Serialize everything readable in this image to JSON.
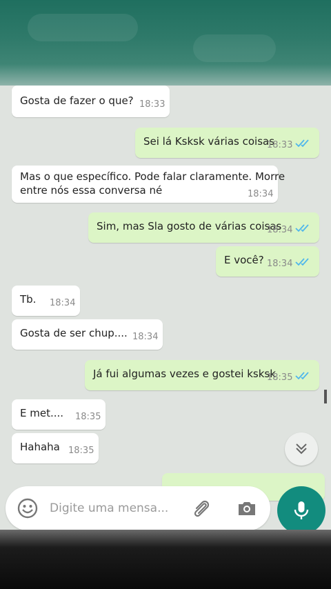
{
  "messages": [
    {
      "dir": "in",
      "text": "Gosta de fazer o que?",
      "time": "18:33"
    },
    {
      "dir": "out",
      "text": "Sei lá Ksksk várias coisas",
      "time": "18:33"
    },
    {
      "dir": "in",
      "text_lines": [
        "Mas o que específico. Pode falar claramente.  Morre",
        "entre nós essa conversa né"
      ],
      "time": "18:34"
    },
    {
      "dir": "out",
      "text": "Sim, mas Sla gosto de várias coisas",
      "time": "18:34"
    },
    {
      "dir": "out",
      "text": "E você?",
      "time": "18:34"
    },
    {
      "dir": "in",
      "text": "Tb.",
      "time": "18:34"
    },
    {
      "dir": "in",
      "text": "Gosta de ser chup....",
      "time": "18:34"
    },
    {
      "dir": "out",
      "text": "Já fui algumas vezes e gostei ksksk",
      "time": "18:35"
    },
    {
      "dir": "in",
      "text": "E met....",
      "time": "18:35"
    },
    {
      "dir": "in",
      "text": "Hahaha",
      "time": "18:35"
    }
  ],
  "composer": {
    "placeholder": "Digite uma mensa..."
  },
  "icons": {
    "emoji": "emoji-icon",
    "attach": "paperclip-icon",
    "camera": "camera-icon",
    "mic": "microphone-icon",
    "scroll_down": "double-chevron-down-icon",
    "read_receipt": "double-check-icon"
  },
  "colors": {
    "header": "#2f7a6a",
    "incoming_bubble": "#ffffff",
    "outgoing_bubble": "#dcf5c6",
    "read_ticks": "#4fb6ec",
    "mic_button": "#128c7e"
  }
}
